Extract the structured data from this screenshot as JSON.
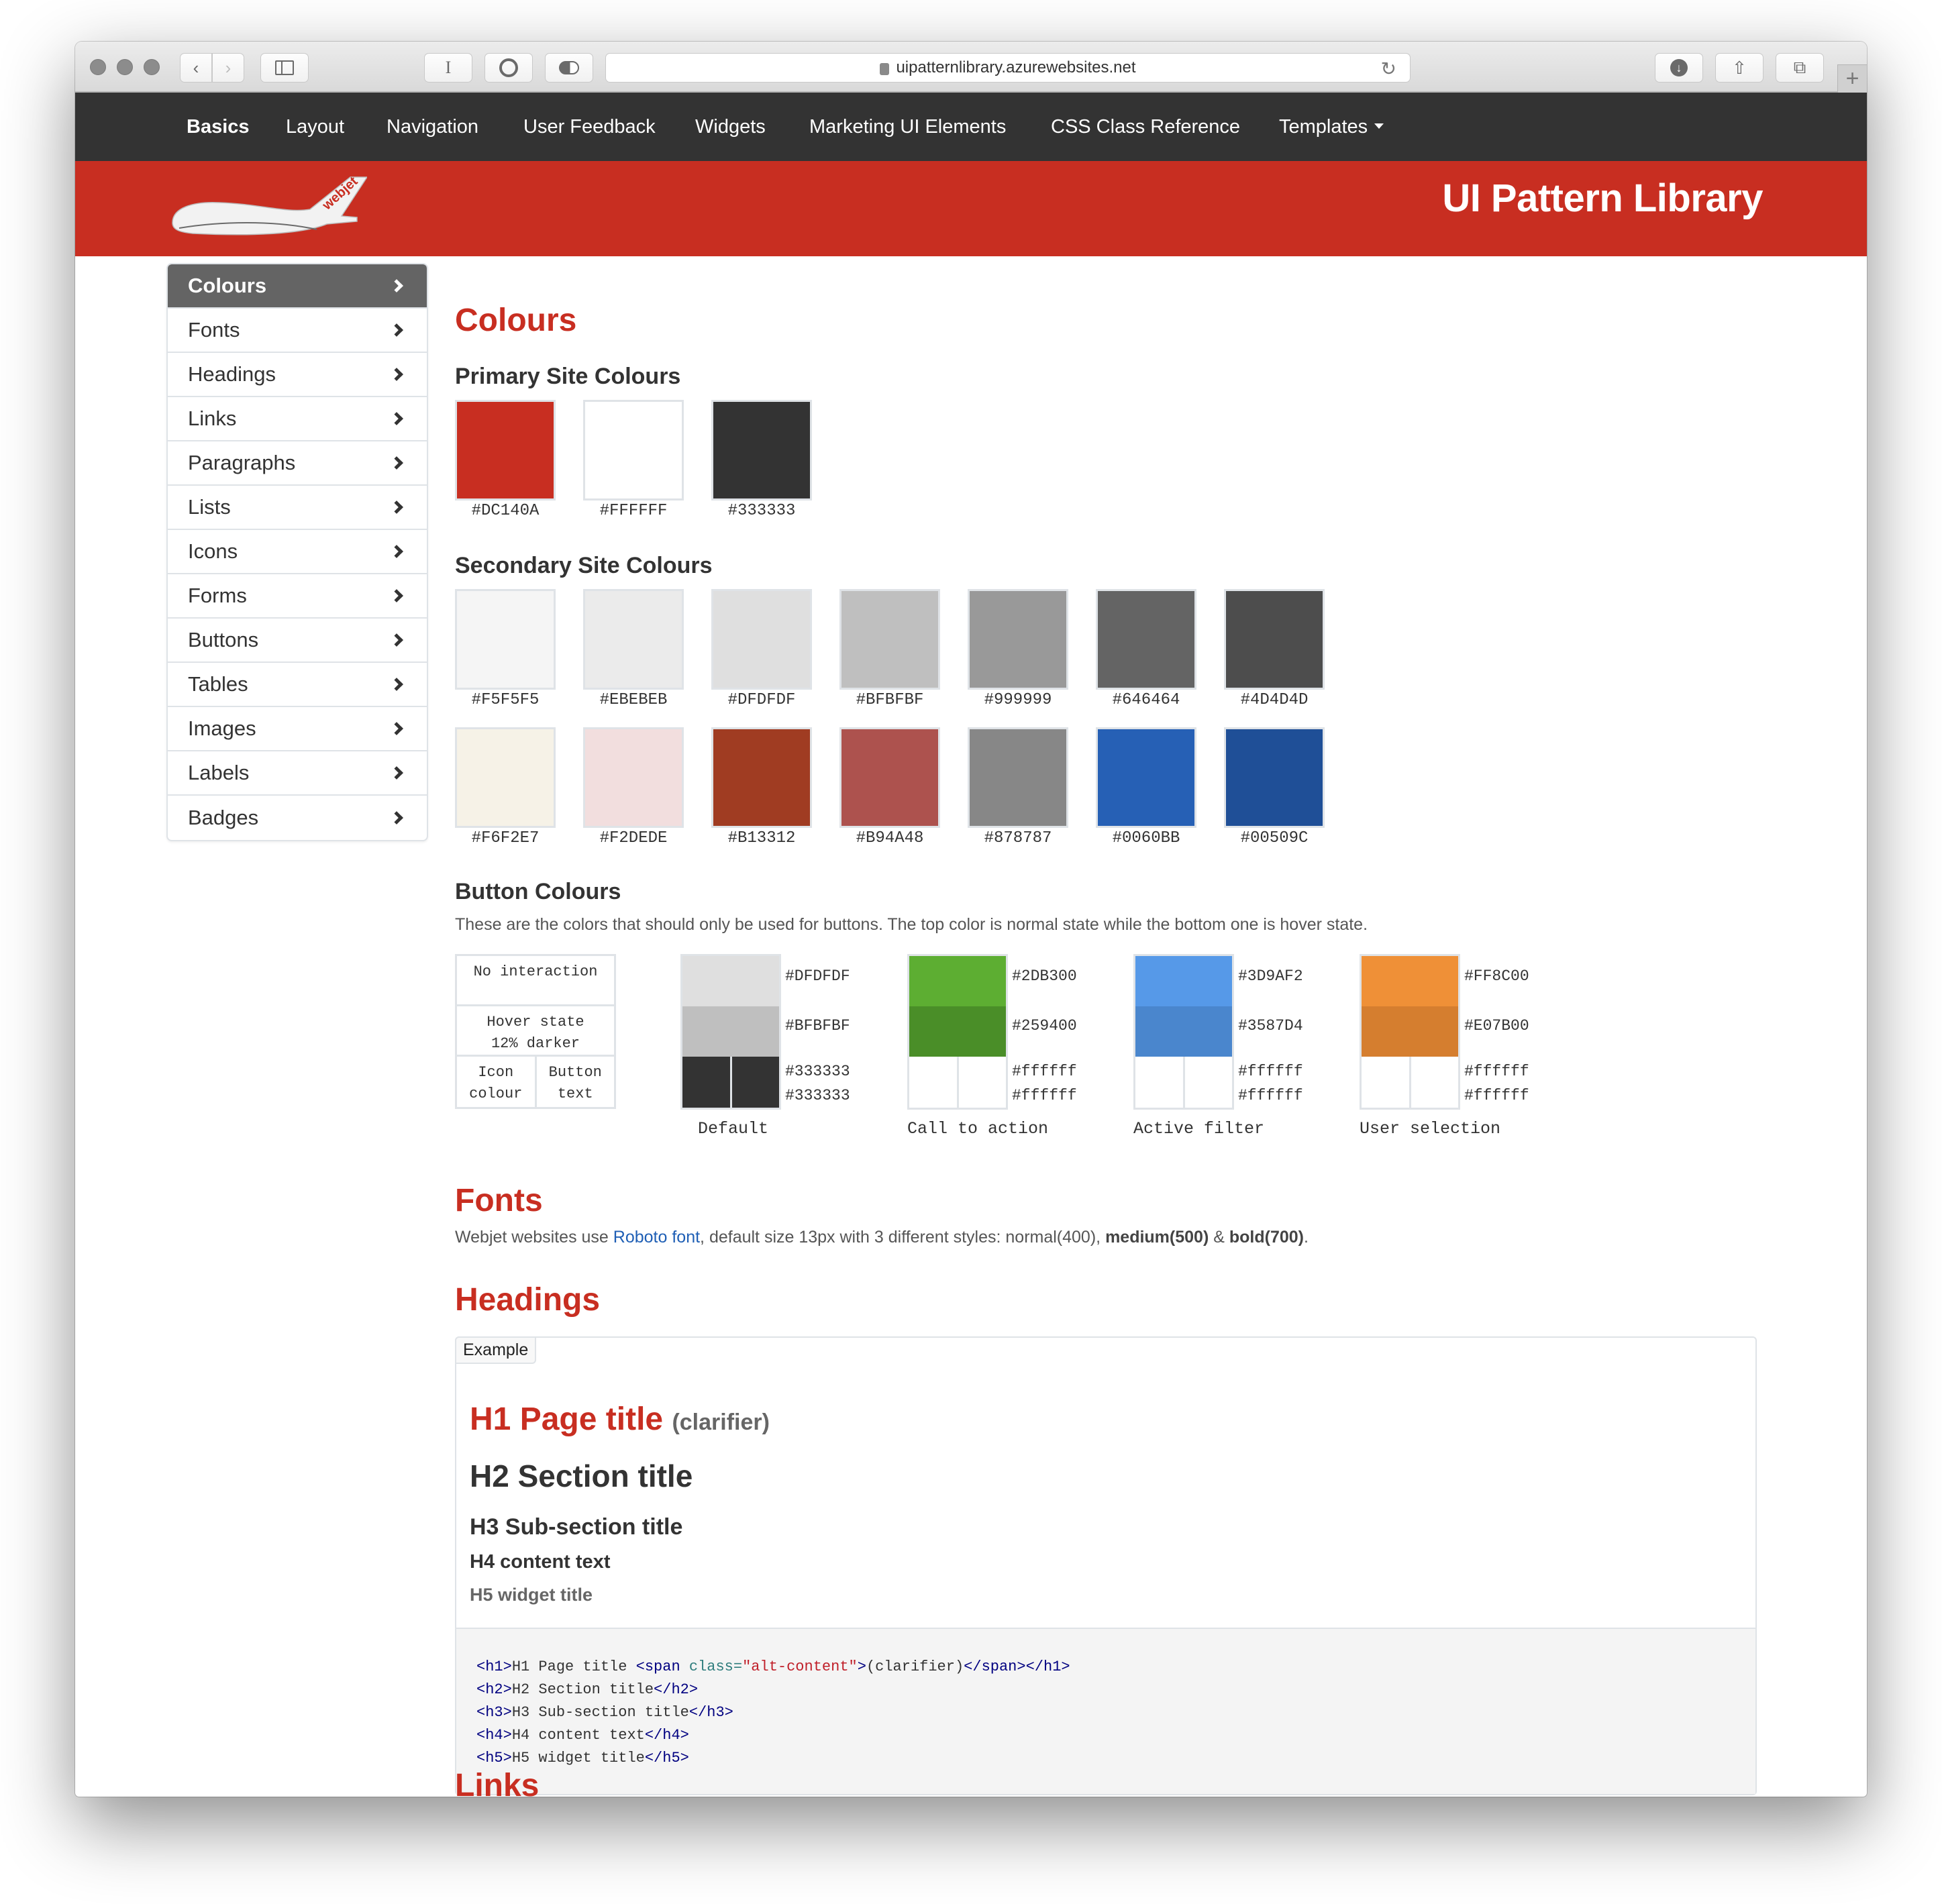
{
  "browser": {
    "url": "uipatternlibrary.azurewebsites.net",
    "toolbar_icons": [
      "back-icon",
      "forward-icon",
      "sidebar-icon",
      "text-cursor-icon",
      "password-manager-icon",
      "toggle-icon",
      "reload-icon",
      "download-icon",
      "share-icon",
      "tabs-icon",
      "new-tab-icon"
    ]
  },
  "nav": {
    "items": [
      {
        "label": "Basics",
        "active": true
      },
      {
        "label": "Layout"
      },
      {
        "label": "Navigation"
      },
      {
        "label": "User Feedback"
      },
      {
        "label": "Widgets"
      },
      {
        "label": "Marketing UI Elements"
      },
      {
        "label": "CSS Class Reference"
      },
      {
        "label": "Templates",
        "dropdown": true
      }
    ]
  },
  "header": {
    "logo_text": "webjet",
    "title": "UI Pattern Library",
    "brand_color": "#C82E21"
  },
  "sidebar": {
    "items": [
      {
        "label": "Colours",
        "active": true
      },
      {
        "label": "Fonts"
      },
      {
        "label": "Headings"
      },
      {
        "label": "Links"
      },
      {
        "label": "Paragraphs"
      },
      {
        "label": "Lists"
      },
      {
        "label": "Icons"
      },
      {
        "label": "Forms"
      },
      {
        "label": "Buttons"
      },
      {
        "label": "Tables"
      },
      {
        "label": "Images"
      },
      {
        "label": "Labels"
      },
      {
        "label": "Badges"
      }
    ]
  },
  "colours": {
    "title": "Colours",
    "primary": {
      "title": "Primary Site Colours",
      "swatches": [
        {
          "hex": "#DC140A",
          "display": "#C82E21"
        },
        {
          "hex": "#FFFFFF",
          "display": "#FFFFFF"
        },
        {
          "hex": "#333333",
          "display": "#333333"
        }
      ]
    },
    "secondary": {
      "title": "Secondary Site Colours",
      "rows": [
        [
          {
            "hex": "#F5F5F5"
          },
          {
            "hex": "#EBEBEB"
          },
          {
            "hex": "#DFDFDF"
          },
          {
            "hex": "#BFBFBF"
          },
          {
            "hex": "#999999"
          },
          {
            "hex": "#646464"
          },
          {
            "hex": "#4D4D4D"
          }
        ],
        [
          {
            "hex": "#F6F2E7"
          },
          {
            "hex": "#F2DEDE"
          },
          {
            "hex": "#B13312",
            "display": "#A03C22"
          },
          {
            "hex": "#B94A48",
            "display": "#AD524E"
          },
          {
            "hex": "#878787"
          },
          {
            "hex": "#0060BB",
            "display": "#2660B5"
          },
          {
            "hex": "#00509C",
            "display": "#1F4F97"
          }
        ]
      ]
    },
    "buttons": {
      "title": "Button Colours",
      "description": "These are the colors that should only be used for buttons. The top color is normal state while the bottom one is hover state.",
      "legend": {
        "no_interaction": "No interaction",
        "hover_line1": "Hover state",
        "hover_line2": "12% darker",
        "icon_line1": "Icon",
        "icon_line2": "colour",
        "text_line1": "Button",
        "text_line2": "text"
      },
      "groups": [
        {
          "name": "Default",
          "normal": "#DFDFDF",
          "hover": "#BFBFBF",
          "icon": "#333333",
          "text": "#333333",
          "normal_display": "#DFDFDF",
          "hover_display": "#BFBFBF",
          "icon_display": "#333333",
          "text_display": "#333333"
        },
        {
          "name": "Call to action",
          "normal": "#2DB300",
          "hover": "#259400",
          "icon": "#ffffff",
          "text": "#ffffff",
          "normal_display": "#5DAE32",
          "hover_display": "#4A8E28",
          "icon_display": "#ffffff",
          "text_display": "#ffffff"
        },
        {
          "name": "Active filter",
          "normal": "#3D9AF2",
          "hover": "#3587D4",
          "icon": "#ffffff",
          "text": "#ffffff",
          "normal_display": "#5699E8",
          "hover_display": "#4A86CD",
          "icon_display": "#ffffff",
          "text_display": "#ffffff"
        },
        {
          "name": "User selection",
          "normal": "#FF8C00",
          "hover": "#E07B00",
          "icon": "#ffffff",
          "text": "#ffffff",
          "normal_display": "#EF9037",
          "hover_display": "#D57E2F",
          "icon_display": "#ffffff",
          "text_display": "#ffffff"
        }
      ]
    }
  },
  "fonts": {
    "title": "Fonts",
    "text_before": "Webjet websites use ",
    "link": "Roboto font",
    "text_middle": ", default size 13px with 3 different styles: normal(400), ",
    "medium": "medium(500)",
    "amp": " & ",
    "bold": "bold(700)",
    "end": "."
  },
  "headings": {
    "title": "Headings",
    "example_tab": "Example",
    "h1": "H1 Page title",
    "h1_clarifier": "(clarifier)",
    "h2": "H2 Section title",
    "h3": "H3 Sub-section title",
    "h4": "H4 content text",
    "h5": "H5 widget title",
    "code": {
      "l1_open": "<h1>",
      "l1_text": "H1 Page title ",
      "l1_span_open": "<span ",
      "l1_attr": "class=",
      "l1_str": "\"alt-content\"",
      "l1_gt": ">",
      "l1_inner": "(clarifier)",
      "l1_close": "</span></h1>",
      "l2_open": "<h2>",
      "l2_text": "H2 Section title",
      "l2_close": "</h2>",
      "l3_open": "<h3>",
      "l3_text": "H3 Sub-section title",
      "l3_close": "</h3>",
      "l4_open": "<h4>",
      "l4_text": "H4 content text",
      "l4_close": "</h4>",
      "l5_open": "<h5>",
      "l5_text": "H5 widget title",
      "l5_close": "</h5>"
    }
  },
  "next_section_partial": "Links"
}
